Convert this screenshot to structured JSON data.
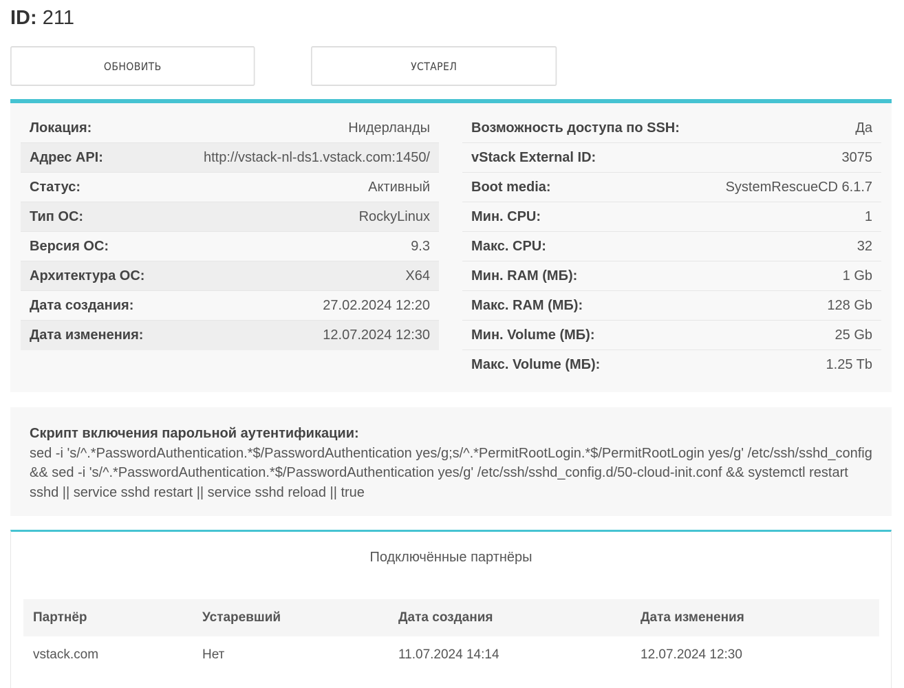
{
  "header": {
    "id_label": "ID:",
    "id_value": "211"
  },
  "actions": {
    "update_label": "Обновить",
    "obsolete_label": "Устарел"
  },
  "colors": {
    "accent": "#46c3d2",
    "panel_bg": "#f8f8f8"
  },
  "details_left": [
    {
      "key": "Локация:",
      "value": "Нидерланды"
    },
    {
      "key": "Адрес API:",
      "value": "http://vstack-nl-ds1.vstack.com:1450/"
    },
    {
      "key": "Статус:",
      "value": "Активный"
    },
    {
      "key": "Тип ОС:",
      "value": "RockyLinux"
    },
    {
      "key": "Версия ОС:",
      "value": "9.3"
    },
    {
      "key": "Архитектура ОС:",
      "value": "X64"
    },
    {
      "key": "Дата создания:",
      "value": "27.02.2024 12:20"
    },
    {
      "key": "Дата изменения:",
      "value": "12.07.2024 12:30"
    }
  ],
  "details_right": [
    {
      "key": "Возможность доступа по SSH:",
      "value": "Да"
    },
    {
      "key": "vStack External ID:",
      "value": "3075"
    },
    {
      "key": "Boot media:",
      "value": "SystemRescueCD 6.1.7"
    },
    {
      "key": "Мин. CPU:",
      "value": "1"
    },
    {
      "key": "Макс. CPU:",
      "value": "32"
    },
    {
      "key": "Мин. RAM (МБ):",
      "value": "1 Gb"
    },
    {
      "key": "Макс. RAM (МБ):",
      "value": "128 Gb"
    },
    {
      "key": "Мин. Volume (МБ):",
      "value": "25 Gb"
    },
    {
      "key": "Макс. Volume (МБ):",
      "value": "1.25 Tb"
    }
  ],
  "script": {
    "title": "Скрипт включения парольной аутентификации:",
    "command": "sed -i 's/^.*PasswordAuthentication.*$/PasswordAuthentication yes/g;s/^.*PermitRootLogin.*$/PermitRootLogin yes/g' /etc/ssh/sshd_config && sed -i 's/^.*PasswordAuthentication.*$/PasswordAuthentication yes/g' /etc/ssh/sshd_config.d/50-cloud-init.conf && systemctl restart sshd || service sshd restart || service sshd reload || true"
  },
  "partners": {
    "title": "Подключённые партнёры",
    "columns": [
      "Партнёр",
      "Устаревший",
      "Дата создания",
      "Дата изменения"
    ],
    "rows": [
      [
        "vstack.com",
        "Нет",
        "11.07.2024 14:14",
        "12.07.2024 12:30"
      ]
    ]
  }
}
